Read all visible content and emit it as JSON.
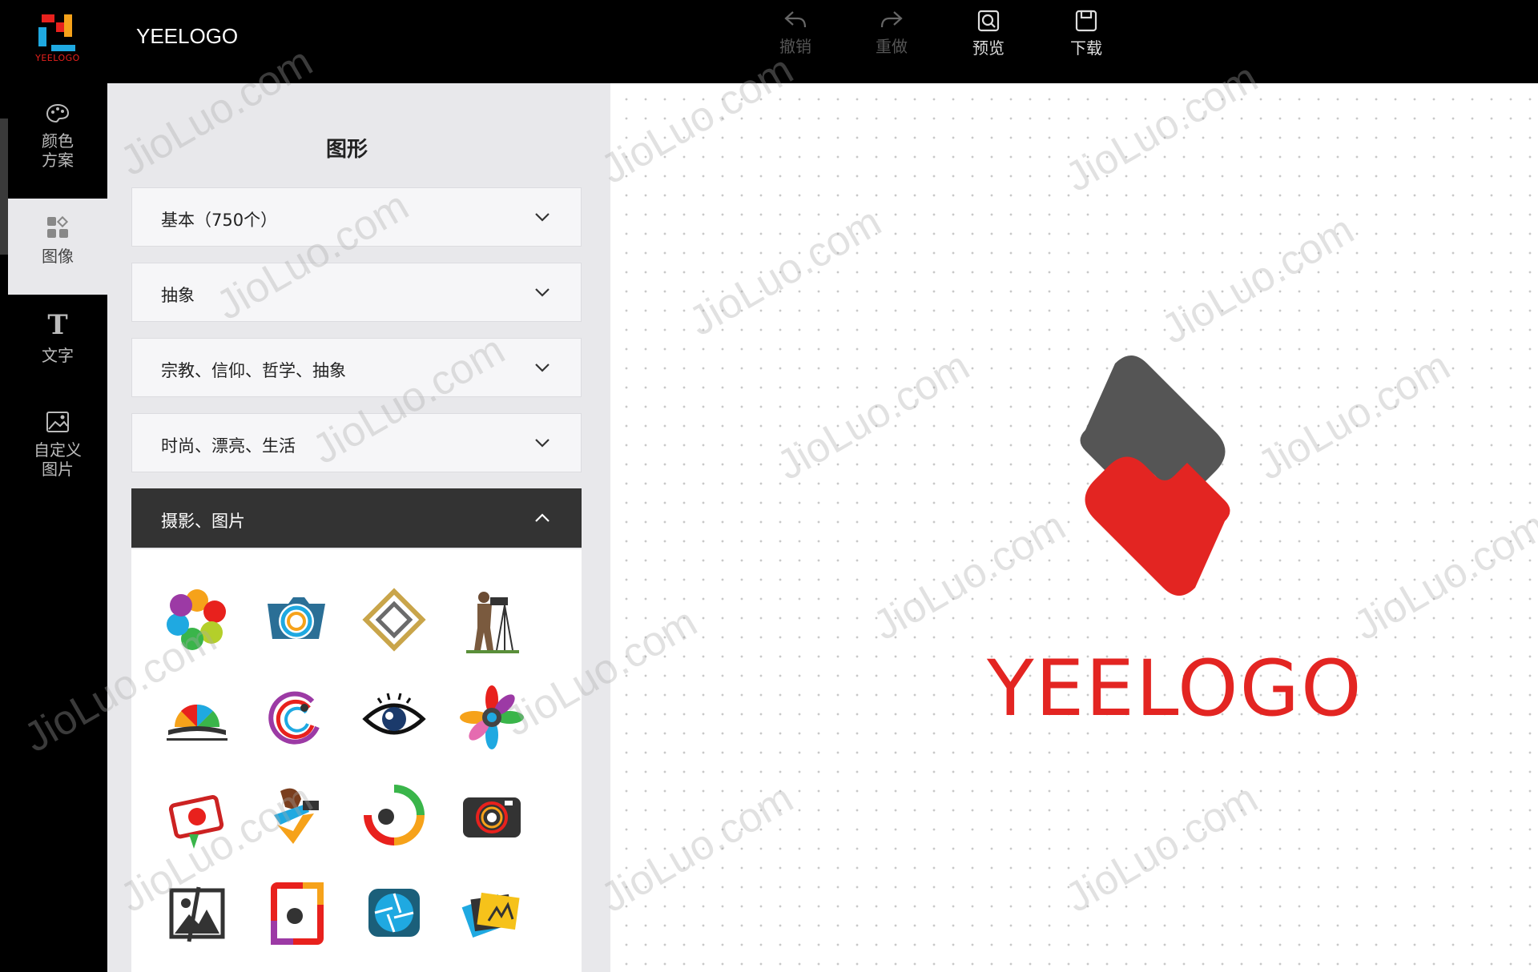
{
  "app": {
    "title": "YEELOGO",
    "logo_text": "YEELOGO"
  },
  "toolbar": [
    {
      "label": "撤销",
      "icon": "undo-icon"
    },
    {
      "label": "重做",
      "icon": "redo-icon"
    },
    {
      "label": "预览",
      "icon": "preview-icon"
    },
    {
      "label": "下载",
      "icon": "download-icon"
    }
  ],
  "sidebar": {
    "items": [
      {
        "label": "颜色\n方案",
        "icon": "palette-icon"
      },
      {
        "label": "图像",
        "icon": "shapes-icon"
      },
      {
        "label": "文字",
        "icon": "text-icon"
      },
      {
        "label": "自定义\n图片",
        "icon": "image-icon"
      }
    ]
  },
  "panel": {
    "title": "图形",
    "categories": [
      {
        "label": "基本（750个）"
      },
      {
        "label": "抽象"
      },
      {
        "label": "宗教、信仰、哲学、抽象"
      },
      {
        "label": "时尚、漂亮、生活"
      },
      {
        "label": "摄影、图片"
      }
    ]
  },
  "canvas": {
    "brand_text": "YEELOGO"
  },
  "watermark": {
    "text": "JioLuo.com"
  },
  "colors": {
    "brand_red": "#e32522",
    "logo_gray": "#555555",
    "topbar": "#000000",
    "panel": "#e8e8eb"
  }
}
